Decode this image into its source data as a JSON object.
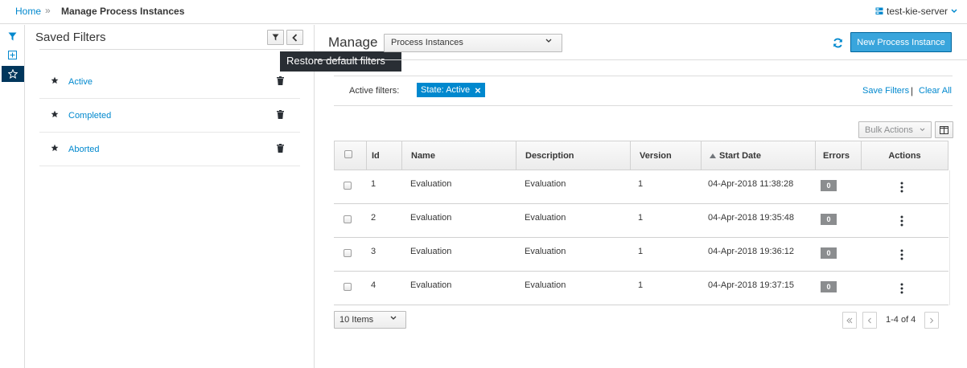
{
  "breadcrumb": {
    "home": "Home",
    "separator": "»",
    "current": "Manage Process Instances"
  },
  "server": {
    "name": "test-kie-server"
  },
  "rail": {
    "icons": [
      "filter-icon",
      "add-icon",
      "star-icon"
    ]
  },
  "saved_filters": {
    "title": "Saved Filters",
    "tooltip": "Restore default filters",
    "items": [
      {
        "label": "Active"
      },
      {
        "label": "Completed"
      },
      {
        "label": "Aborted"
      }
    ]
  },
  "main": {
    "manage_label": "Manage",
    "select_value": "Process Instances",
    "new_button": "New Process Instance"
  },
  "filters": {
    "active_label": "Active filters:",
    "chip": "State: Active",
    "chip_close": "×",
    "save": "Save Filters",
    "separator": "|",
    "clear": "Clear All"
  },
  "toolbar": {
    "bulk_actions": "Bulk Actions"
  },
  "table": {
    "headers": [
      "Id",
      "Name",
      "Description",
      "Version",
      "Start Date",
      "Errors",
      "Actions"
    ],
    "rows": [
      {
        "id": "1",
        "name": "Evaluation",
        "description": "Evaluation",
        "version": "1",
        "start_date": "04-Apr-2018 11:38:28",
        "errors": "0"
      },
      {
        "id": "2",
        "name": "Evaluation",
        "description": "Evaluation",
        "version": "1",
        "start_date": "04-Apr-2018 19:35:48",
        "errors": "0"
      },
      {
        "id": "3",
        "name": "Evaluation",
        "description": "Evaluation",
        "version": "1",
        "start_date": "04-Apr-2018 19:36:12",
        "errors": "0"
      },
      {
        "id": "4",
        "name": "Evaluation",
        "description": "Evaluation",
        "version": "1",
        "start_date": "04-Apr-2018 19:37:15",
        "errors": "0"
      }
    ]
  },
  "pagination": {
    "items_per_page": "10 Items",
    "info": "1-4 of 4"
  },
  "colors": {
    "link": "#0088ce",
    "primary_button": "#39a5dc",
    "rail_active": "#00365c",
    "badge": "#8b8d8f",
    "tooltip": "#292e34"
  }
}
